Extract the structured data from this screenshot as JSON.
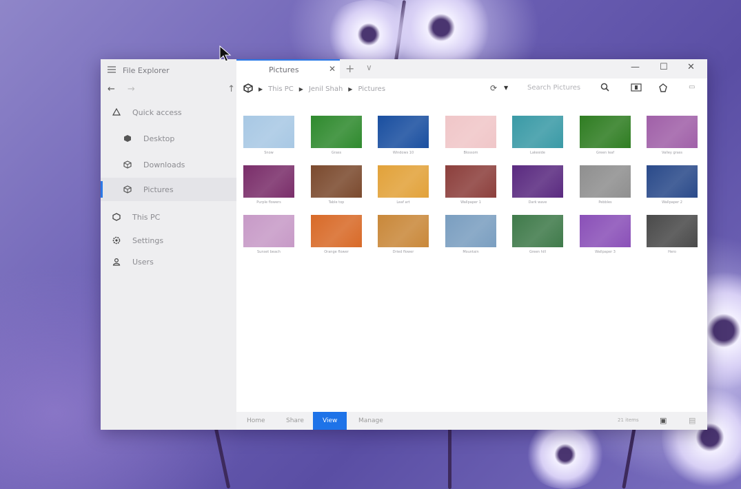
{
  "window": {
    "app_title": "File Explorer",
    "menu_icon": "hamburger-icon",
    "nav": {
      "back": "←",
      "forward": "→",
      "up": "↑"
    }
  },
  "sidebar": {
    "items": [
      {
        "label": "Quick access",
        "icon": "pin-icon"
      },
      {
        "label": "Desktop",
        "icon": "cube-icon"
      },
      {
        "label": "Downloads",
        "icon": "cube-icon"
      },
      {
        "label": "Pictures",
        "icon": "cube-icon",
        "selected": true
      },
      {
        "label": "This PC",
        "icon": "pc-icon"
      },
      {
        "label": "Settings",
        "icon": "gear-icon"
      },
      {
        "label": "Users",
        "icon": "user-icon"
      }
    ]
  },
  "tabs": [
    {
      "label": "Pictures",
      "close": "✕"
    }
  ],
  "tab_controls": {
    "new_tab": "+",
    "chevron": "∨"
  },
  "window_controls": {
    "minimize": "—",
    "maximize": "☐",
    "close": "✕"
  },
  "address": {
    "crumbs": [
      "This PC",
      "Jenil Shah",
      "Pictures"
    ],
    "search_placeholder": "Search Pictures"
  },
  "pictures": [
    {
      "name": "Snow",
      "color": "#a8c8e4"
    },
    {
      "name": "Grass",
      "color": "#2f8a2e"
    },
    {
      "name": "Windows 10",
      "color": "#1a4fa0"
    },
    {
      "name": "Blossom",
      "color": "#f0c6c8"
    },
    {
      "name": "Lakeside",
      "color": "#3a9aa6"
    },
    {
      "name": "Green leaf",
      "color": "#2f7d22"
    },
    {
      "name": "Valley grass",
      "color": "#a060a8"
    },
    {
      "name": "Purple flowers",
      "color": "#7a2e6a"
    },
    {
      "name": "Table top",
      "color": "#7b4a2e"
    },
    {
      "name": "Leaf art",
      "color": "#e2a23a"
    },
    {
      "name": "Wallpaper 1",
      "color": "#8c3f3c"
    },
    {
      "name": "Dark wave",
      "color": "#5a2a80"
    },
    {
      "name": "Pebbles",
      "color": "#8f8f8f"
    },
    {
      "name": "Wallpaper 2",
      "color": "#2a4a8a"
    },
    {
      "name": "Sunset beach",
      "color": "#c79ac7"
    },
    {
      "name": "Orange flower",
      "color": "#d86a28"
    },
    {
      "name": "Dried flower",
      "color": "#c9883a"
    },
    {
      "name": "Mountain",
      "color": "#7a9ec0"
    },
    {
      "name": "Green hill",
      "color": "#3f7a4a"
    },
    {
      "name": "Wallpaper 3",
      "color": "#8a50b8"
    },
    {
      "name": "Hero",
      "color": "#4a4a4a"
    }
  ],
  "ribbon": {
    "tabs": [
      "Home",
      "Share",
      "View",
      "Manage"
    ],
    "active": "View"
  },
  "status": {
    "item_count": "21 items"
  }
}
